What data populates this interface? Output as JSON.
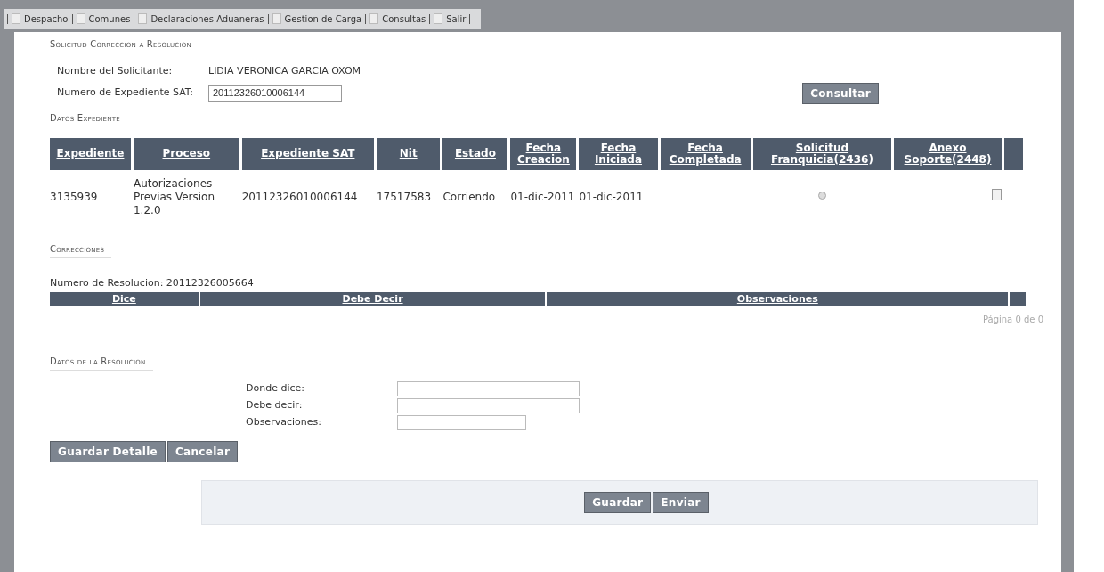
{
  "menu": [
    {
      "label": "Despacho"
    },
    {
      "label": "Comunes"
    },
    {
      "label": "Declaraciones Aduaneras"
    },
    {
      "label": "Gestion de Carga"
    },
    {
      "label": "Consultas"
    },
    {
      "label": "Salir"
    }
  ],
  "request": {
    "title": "Solicitud Correccion a Resolucion",
    "applicant_label": "Nombre del Solicitante:",
    "applicant": "LIDIA VERONICA GARCIA OXOM",
    "file_label": "Numero de Expediente SAT:",
    "file_value": "20112326010006144",
    "query_button": "Consultar"
  },
  "file_data": {
    "title": "Datos Expediente",
    "columns": [
      "Expediente",
      "Proceso",
      "Expediente SAT",
      "Nit",
      "Estado",
      "Fecha Creacion",
      "Fecha Iniciada",
      "Fecha Completada",
      "Solicitud Franquicia(2436)",
      "Anexo Soporte(2448)"
    ],
    "rows": [
      {
        "cells": [
          "3135939",
          "Autorizaciones Previas Version 1.2.0",
          "20112326010006144",
          "17517583",
          "Corriendo",
          "01-dic-2011",
          "01-dic-2011",
          ""
        ]
      }
    ]
  },
  "corrections": {
    "title": "Correcciones",
    "resolution": "Numero de Resolucion: 20112326005664",
    "columns": [
      "Dice",
      "Debe Decir",
      "Observaciones"
    ],
    "pager": "Página 0 de 0"
  },
  "resolution": {
    "title": "Datos de la Resolucion",
    "fields": [
      {
        "label": "Donde dice:"
      },
      {
        "label": "Debe decir:"
      },
      {
        "label": "Observaciones:"
      }
    ],
    "buttons": [
      "Guardar Detalle",
      "Cancelar"
    ]
  },
  "footer_buttons": [
    "Guardar",
    "Enviar"
  ]
}
